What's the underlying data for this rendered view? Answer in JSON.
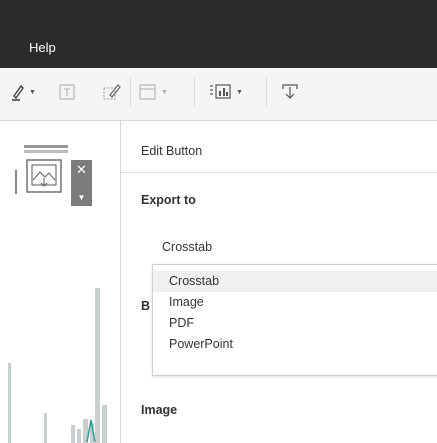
{
  "menubar": {
    "help_label": "Help"
  },
  "toolbar": {
    "icons": [
      "highlighter-icon",
      "text-box-icon",
      "annotate-icon",
      "frame-icon",
      "chart-icon",
      "export-download-icon"
    ]
  },
  "panel": {
    "title": "Edit Button",
    "export_label": "Export to",
    "selected_value": "Crosstab",
    "partial_label": "B",
    "image_label": "Image"
  },
  "dropdown": {
    "options": [
      "Crosstab",
      "Image",
      "PDF",
      "PowerPoint"
    ],
    "selected": "Crosstab"
  },
  "colors": {
    "menubar": "#2b2b2b",
    "toolbar": "#f5f5f5",
    "selected_option": "#f0f0f0",
    "object_close_bg": "#7c7c7c",
    "chart_bar": "#c9cfd1",
    "chart_accent": "#2b9c8f"
  }
}
